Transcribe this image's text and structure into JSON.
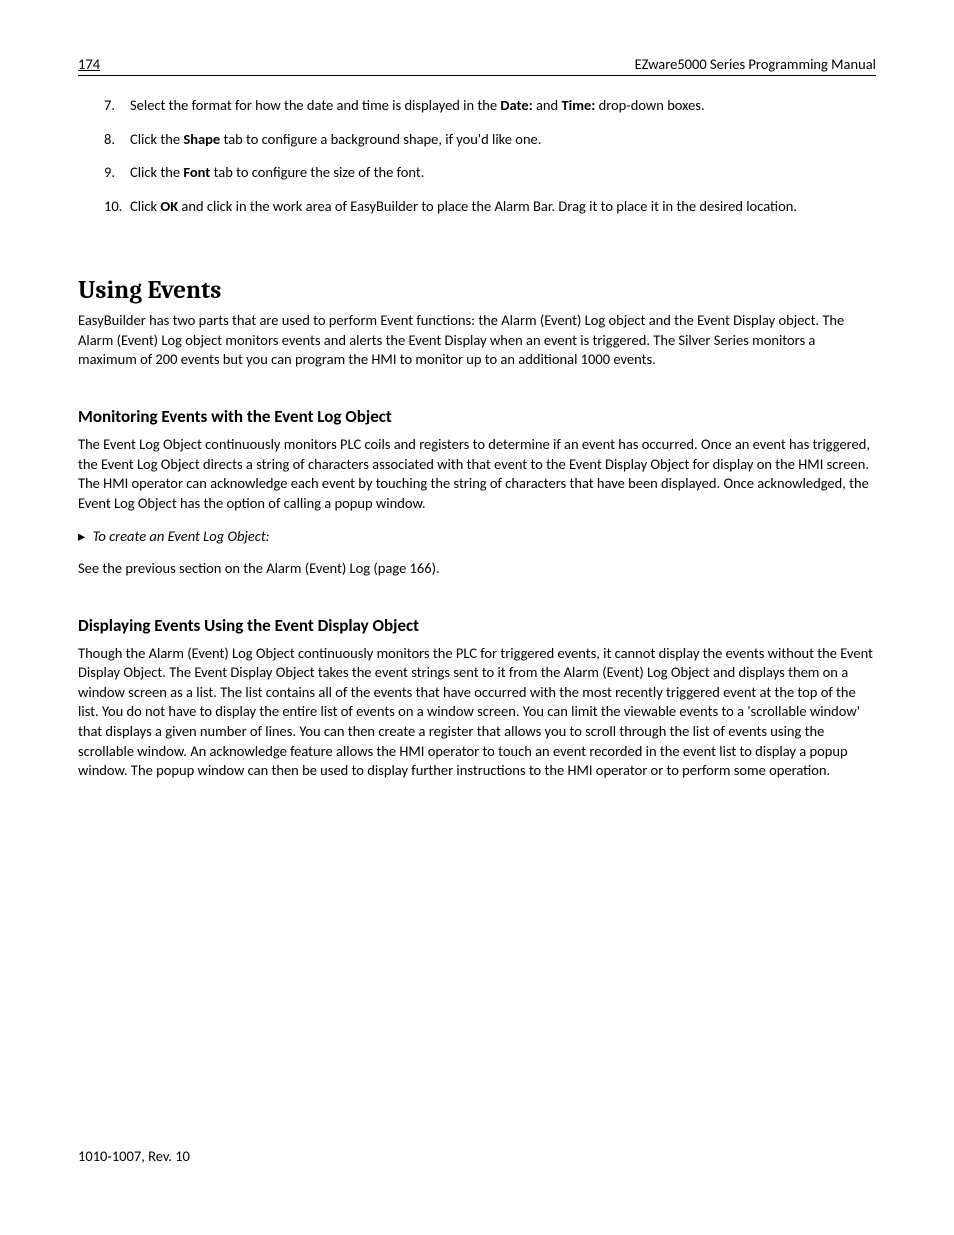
{
  "header": {
    "page_number": "174",
    "manual_title": "EZware5000 Series Programming Manual"
  },
  "list_items": [
    {
      "marker": "7.",
      "segments": [
        {
          "text": "Select the format for how the date and time is displayed in the ",
          "bold": false
        },
        {
          "text": "Date:",
          "bold": true
        },
        {
          "text": " and ",
          "bold": false
        },
        {
          "text": "Time:",
          "bold": true
        },
        {
          "text": " drop-down boxes.",
          "bold": false
        }
      ]
    },
    {
      "marker": "8.",
      "segments": [
        {
          "text": "Click the ",
          "bold": false
        },
        {
          "text": "Shape",
          "bold": true
        },
        {
          "text": " tab to configure a background shape, if you'd like one.",
          "bold": false
        }
      ]
    },
    {
      "marker": "9.",
      "segments": [
        {
          "text": "Click the ",
          "bold": false
        },
        {
          "text": "Font",
          "bold": true
        },
        {
          "text": " tab to configure the size of the font.",
          "bold": false
        }
      ]
    },
    {
      "marker": "10.",
      "segments": [
        {
          "text": "Click ",
          "bold": false
        },
        {
          "text": "OK",
          "bold": true
        },
        {
          "text": " and click in the work area of EasyBuilder to place the Alarm Bar. Drag it to place it in the desired location.",
          "bold": false
        }
      ]
    }
  ],
  "section_heading": "Using Events",
  "intro_para": "EasyBuilder has two parts that are used to perform Event functions: the Alarm (Event) Log object and the Event Display object. The Alarm (Event) Log object monitors events and alerts the Event Display when an event is triggered. The Silver Series monitors a maximum of 200 events but you can program the HMI to monitor up to an additional 1000 events.",
  "sub1_heading": "Monitoring Events with the Event Log Object",
  "sub1_para": "The Event Log Object continuously monitors PLC coils and registers to determine if an event has occurred. Once an event has triggered, the Event Log Object directs a string of characters associated with that event to the Event Display Object for display on the HMI screen. The HMI operator can acknowledge each event by touching the string of characters that have been displayed. Once acknowledged, the Event Log Object has the option of calling a popup window.",
  "howto_text": "To create an Event Log Object:",
  "howto_ref": "See the previous section on the Alarm (Event) Log (page 166).",
  "sub2_heading": "Displaying Events Using the Event Display Object",
  "sub2_para": "Though the Alarm (Event) Log Object continuously monitors the PLC for triggered events, it cannot display the events without the Event Display Object. The Event Display Object takes the event strings sent to it from the Alarm (Event) Log Object and displays them on a window screen as a list. The list contains all of the events that have occurred with the most recently triggered event at the top of the list. You do not have to display the entire list of events on a window screen. You can limit the viewable events to a 'scrollable window' that displays a given number of lines. You can then create a register that allows you to scroll through the list of events using the scrollable window. An acknowledge feature allows the HMI operator to touch an event recorded in the event list to display a popup window. The popup window can then be used to display further instructions to the HMI operator or to perform some operation.",
  "footer": "1010-1007, Rev. 10"
}
